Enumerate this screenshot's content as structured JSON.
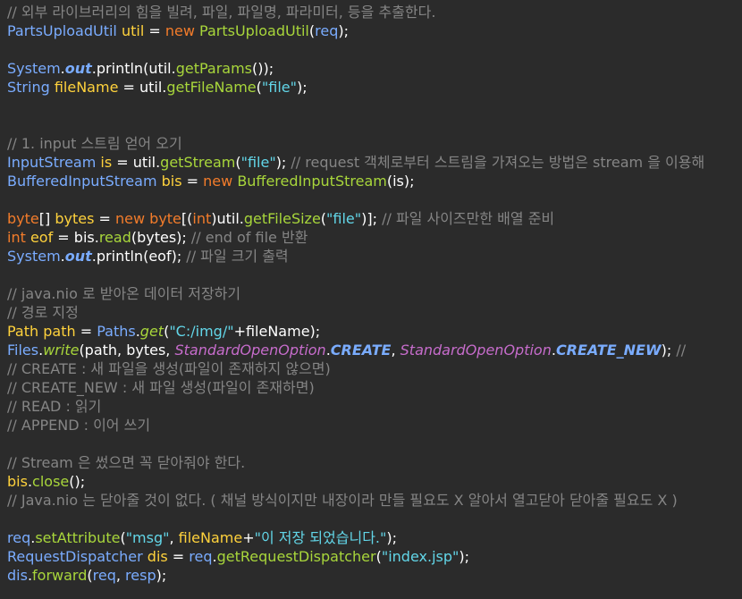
{
  "colors": {
    "background": "#2b2b2b",
    "comment": "#858585",
    "type": "#7aacff",
    "variable": "#ffd23c",
    "keyword": "#f37c2b",
    "method": "#a8d63b",
    "string": "#62d6e8",
    "enum": "#c66ccb",
    "plain": "#ffffff"
  },
  "lines": [
    [
      [
        "comment",
        "// 외부 라이브러리의 힘을 빌려, 파일, 파일명, 파라미터, 등을 추출한다."
      ]
    ],
    [
      [
        "type",
        "PartsUploadUtil"
      ],
      [
        "plain",
        " "
      ],
      [
        "var",
        "util"
      ],
      [
        "plain",
        " = "
      ],
      [
        "kw",
        "new"
      ],
      [
        "plain",
        " "
      ],
      [
        "method",
        "PartsUploadUtil"
      ],
      [
        "plain",
        "("
      ],
      [
        "type",
        "req"
      ],
      [
        "plain",
        ");"
      ]
    ],
    [],
    [
      [
        "type",
        "System"
      ],
      [
        "plain",
        "."
      ],
      [
        "field",
        "out"
      ],
      [
        "plain",
        "."
      ],
      [
        "plain",
        "println(util."
      ],
      [
        "method",
        "getParams"
      ],
      [
        "plain",
        "());"
      ]
    ],
    [
      [
        "type",
        "String"
      ],
      [
        "plain",
        " "
      ],
      [
        "var",
        "fileName"
      ],
      [
        "plain",
        " = util."
      ],
      [
        "method",
        "getFileName"
      ],
      [
        "plain",
        "("
      ],
      [
        "string",
        "\"file\""
      ],
      [
        "plain",
        ");"
      ]
    ],
    [],
    [],
    [
      [
        "comment",
        "// 1. input 스트림 얻어 오기"
      ]
    ],
    [
      [
        "type",
        "InputStream"
      ],
      [
        "plain",
        " "
      ],
      [
        "var",
        "is"
      ],
      [
        "plain",
        " = util."
      ],
      [
        "method",
        "getStream"
      ],
      [
        "plain",
        "("
      ],
      [
        "string",
        "\"file\""
      ],
      [
        "plain",
        "); "
      ],
      [
        "comment",
        "// request 객체로부터 스트림을 가져오는 방법은 stream 을 이용해"
      ]
    ],
    [
      [
        "type",
        "BufferedInputStream"
      ],
      [
        "plain",
        " "
      ],
      [
        "var",
        "bis"
      ],
      [
        "plain",
        " = "
      ],
      [
        "kw",
        "new"
      ],
      [
        "plain",
        " "
      ],
      [
        "method",
        "BufferedInputStream"
      ],
      [
        "plain",
        "(is);"
      ]
    ],
    [],
    [
      [
        "kw",
        "byte"
      ],
      [
        "plain",
        "[] "
      ],
      [
        "var",
        "bytes"
      ],
      [
        "plain",
        " = "
      ],
      [
        "kw",
        "new"
      ],
      [
        "plain",
        " "
      ],
      [
        "kw",
        "byte"
      ],
      [
        "plain",
        "[("
      ],
      [
        "kw",
        "int"
      ],
      [
        "plain",
        ")util."
      ],
      [
        "method",
        "getFileSize"
      ],
      [
        "plain",
        "("
      ],
      [
        "string",
        "\"file\""
      ],
      [
        "plain",
        ")]; "
      ],
      [
        "comment",
        "// 파일 사이즈만한 배열 준비"
      ]
    ],
    [
      [
        "kw",
        "int"
      ],
      [
        "plain",
        " "
      ],
      [
        "var",
        "eof"
      ],
      [
        "plain",
        " = bis."
      ],
      [
        "method",
        "read"
      ],
      [
        "plain",
        "(bytes); "
      ],
      [
        "comment",
        "// end of file 반환"
      ]
    ],
    [
      [
        "type",
        "System"
      ],
      [
        "plain",
        "."
      ],
      [
        "field",
        "out"
      ],
      [
        "plain",
        "."
      ],
      [
        "plain",
        "println(eof); "
      ],
      [
        "comment",
        "// 파일 크기 출력"
      ]
    ],
    [],
    [
      [
        "comment",
        "// java.nio 로 받아온 데이터 저장하기"
      ]
    ],
    [
      [
        "comment",
        "// 경로 지정"
      ]
    ],
    [
      [
        "var",
        "Path"
      ],
      [
        "plain",
        " "
      ],
      [
        "var",
        "path"
      ],
      [
        "plain",
        " = "
      ],
      [
        "type",
        "Paths"
      ],
      [
        "plain",
        "."
      ],
      [
        "static",
        "get"
      ],
      [
        "plain",
        "("
      ],
      [
        "string",
        "\"C:/img/\""
      ],
      [
        "plain",
        "+fileName);"
      ]
    ],
    [
      [
        "type",
        "Files"
      ],
      [
        "plain",
        "."
      ],
      [
        "static",
        "write"
      ],
      [
        "plain",
        "(path, bytes, "
      ],
      [
        "enum",
        "StandardOpenOption"
      ],
      [
        "plain",
        "."
      ],
      [
        "const",
        "CREATE"
      ],
      [
        "plain",
        ", "
      ],
      [
        "enum",
        "StandardOpenOption"
      ],
      [
        "plain",
        "."
      ],
      [
        "const",
        "CREATE_NEW"
      ],
      [
        "plain",
        "); "
      ],
      [
        "comment",
        "//"
      ]
    ],
    [
      [
        "comment",
        "// CREATE : 새 파일을 생성(파일이 존재하지 않으면)"
      ]
    ],
    [
      [
        "comment",
        "// CREATE_NEW : 새 파일 생성(파일이 존재하면)"
      ]
    ],
    [
      [
        "comment",
        "// READ : 읽기"
      ]
    ],
    [
      [
        "comment",
        "// APPEND : 이어 쓰기"
      ]
    ],
    [],
    [
      [
        "comment",
        "// Stream 은 썼으면 꼭 닫아줘야 한다."
      ]
    ],
    [
      [
        "var",
        "bis"
      ],
      [
        "plain",
        "."
      ],
      [
        "method",
        "close"
      ],
      [
        "plain",
        "();"
      ]
    ],
    [
      [
        "comment",
        "// Java.nio 는 닫아줄 것이 없다. ( 채널 방식이지만 내장이라 만들 필요도 X 알아서 열고닫아 닫아줄 필요도 X )"
      ]
    ],
    [],
    [
      [
        "type",
        "req"
      ],
      [
        "plain",
        "."
      ],
      [
        "method",
        "setAttribute"
      ],
      [
        "plain",
        "("
      ],
      [
        "string",
        "\"msg\""
      ],
      [
        "plain",
        ", "
      ],
      [
        "var",
        "fileName"
      ],
      [
        "plain",
        "+"
      ],
      [
        "string",
        "\"이 저장 되었습니다.\""
      ],
      [
        "plain",
        ");"
      ]
    ],
    [
      [
        "type",
        "RequestDispatcher"
      ],
      [
        "plain",
        " "
      ],
      [
        "var",
        "dis"
      ],
      [
        "plain",
        " = "
      ],
      [
        "type",
        "req"
      ],
      [
        "plain",
        "."
      ],
      [
        "method",
        "getRequestDispatcher"
      ],
      [
        "plain",
        "("
      ],
      [
        "string",
        "\"index.jsp\""
      ],
      [
        "plain",
        ");"
      ]
    ],
    [
      [
        "type",
        "dis"
      ],
      [
        "plain",
        "."
      ],
      [
        "method",
        "forward"
      ],
      [
        "plain",
        "("
      ],
      [
        "type",
        "req"
      ],
      [
        "plain",
        ", "
      ],
      [
        "type",
        "resp"
      ],
      [
        "plain",
        ");"
      ]
    ]
  ]
}
